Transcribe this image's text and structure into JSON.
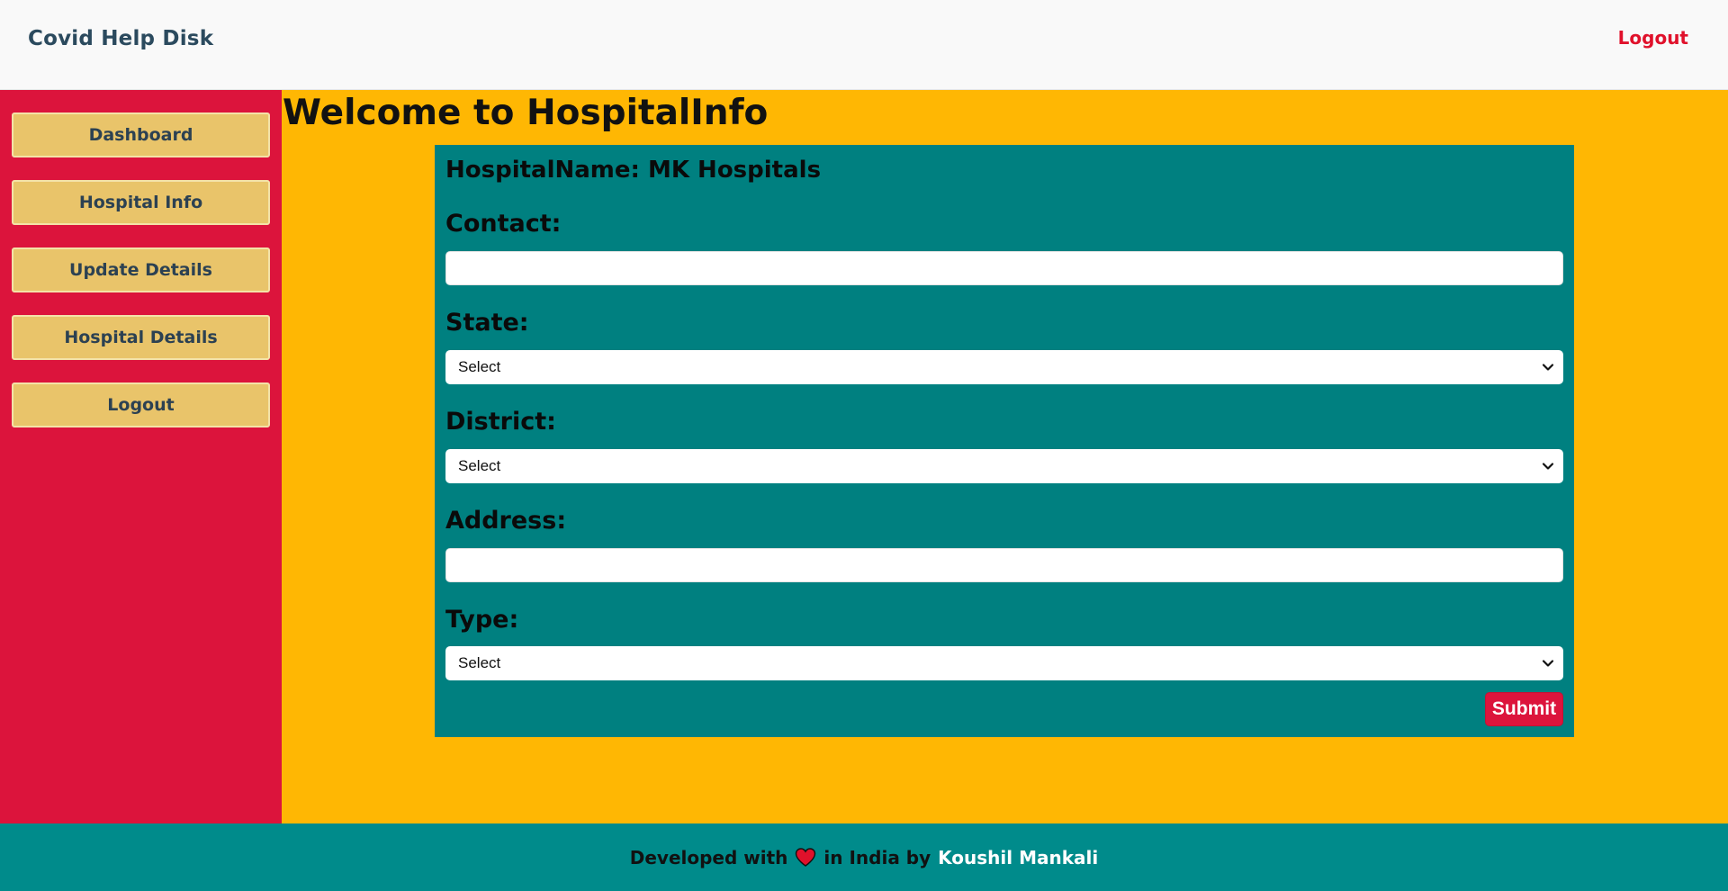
{
  "navbar": {
    "brand": "Covid Help Disk",
    "logout_label": "Logout"
  },
  "sidebar": {
    "items": [
      {
        "label": "Dashboard"
      },
      {
        "label": "Hospital Info"
      },
      {
        "label": "Update Details"
      },
      {
        "label": "Hospital Details"
      },
      {
        "label": "Logout"
      }
    ]
  },
  "main": {
    "title": "Welcome to HospitalInfo",
    "form": {
      "hospital_name": "HospitalName: MK Hospitals",
      "contact_label": "Contact:",
      "contact_value": "",
      "state_label": "State:",
      "state_selected": "Select",
      "district_label": "District:",
      "district_selected": "Select",
      "address_label": "Address:",
      "address_value": "",
      "type_label": "Type:",
      "type_selected": "Select",
      "submit_label": "Submit"
    }
  },
  "footer": {
    "prefix": "Developed with",
    "heart_icon": "heart-icon",
    "middle": "in India by",
    "author": "Koushil Mankali"
  },
  "colors": {
    "navbar_bg": "#f9f9f9",
    "brand_text": "#2b4a5e",
    "logout_text": "#e0112b",
    "sidebar_bg": "#dc143c",
    "sidebar_button_bg": "#e9c46a",
    "main_bg": "#ffb703",
    "form_bg": "#008080",
    "submit_bg": "#dc143c",
    "footer_bg": "#008b8b",
    "heart": "#e0112b"
  }
}
